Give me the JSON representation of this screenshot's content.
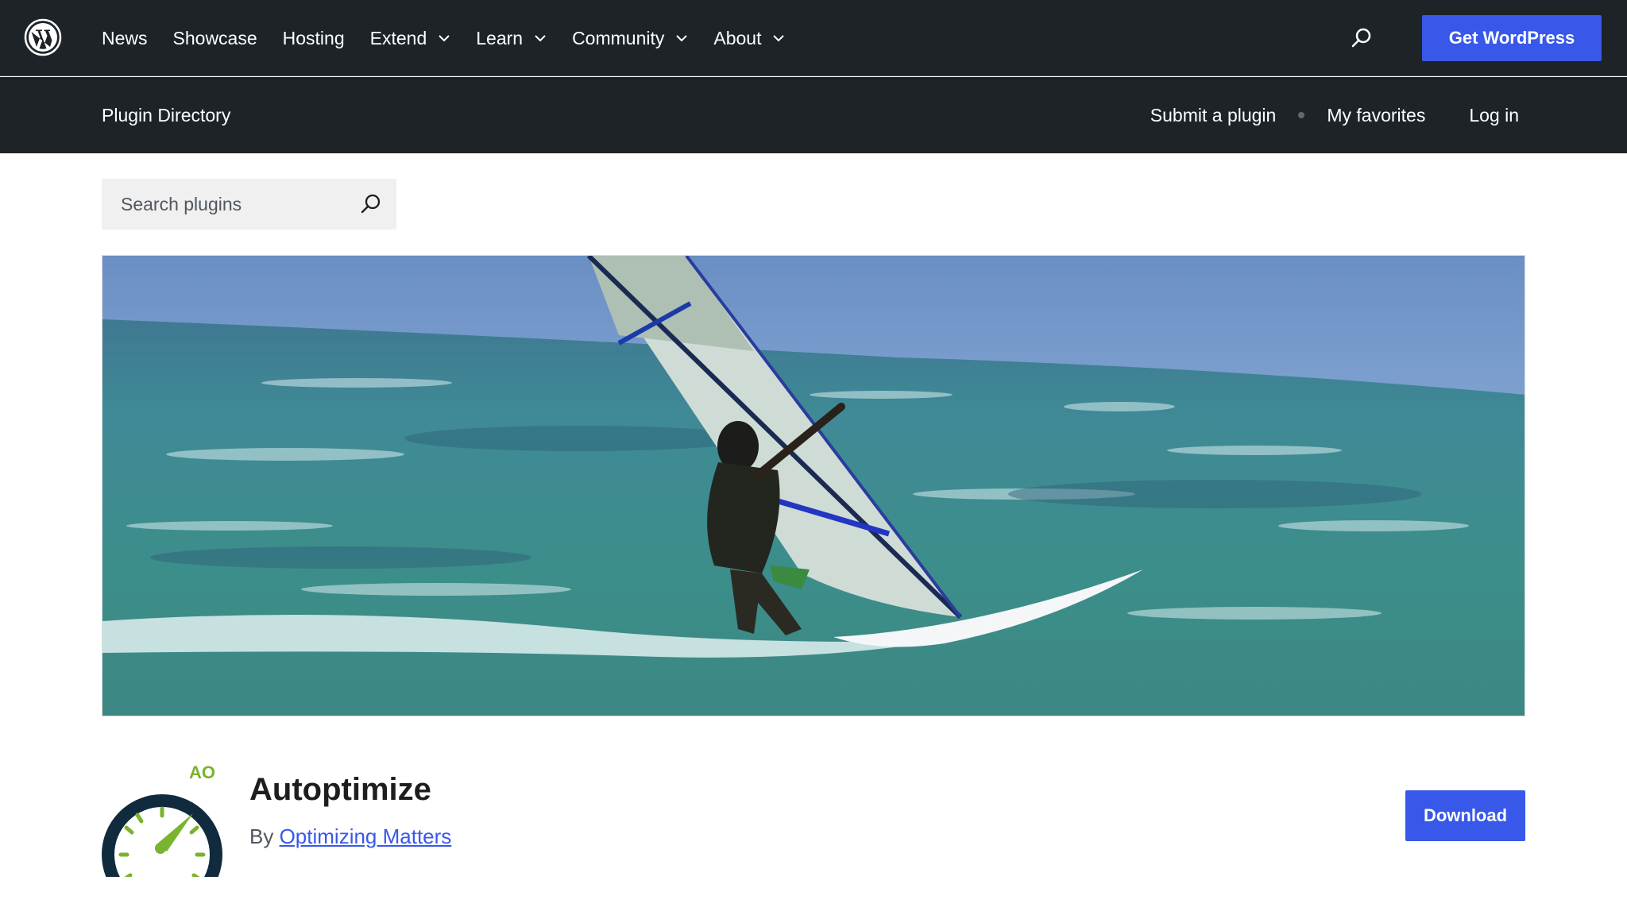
{
  "global_nav": {
    "logo_icon": "wordpress-logo-icon",
    "items": [
      {
        "label": "News",
        "has_dropdown": false
      },
      {
        "label": "Showcase",
        "has_dropdown": false
      },
      {
        "label": "Hosting",
        "has_dropdown": false
      },
      {
        "label": "Extend",
        "has_dropdown": true
      },
      {
        "label": "Learn",
        "has_dropdown": true
      },
      {
        "label": "Community",
        "has_dropdown": true
      },
      {
        "label": "About",
        "has_dropdown": true
      }
    ],
    "search_icon": "search-icon",
    "cta_label": "Get WordPress"
  },
  "sub_nav": {
    "title": "Plugin Directory",
    "submit_label": "Submit a plugin",
    "favorites_label": "My favorites",
    "login_label": "Log in"
  },
  "search": {
    "placeholder": "Search plugins",
    "value": ""
  },
  "plugin": {
    "icon_text": "AO",
    "name": "Autoptimize",
    "by_label": "By",
    "author": "Optimizing Matters",
    "download_label": "Download"
  },
  "colors": {
    "nav_bg": "#1d2327",
    "accent": "#3858e9",
    "icon_green": "#7ab32e",
    "icon_navy": "#0f2b3d"
  }
}
